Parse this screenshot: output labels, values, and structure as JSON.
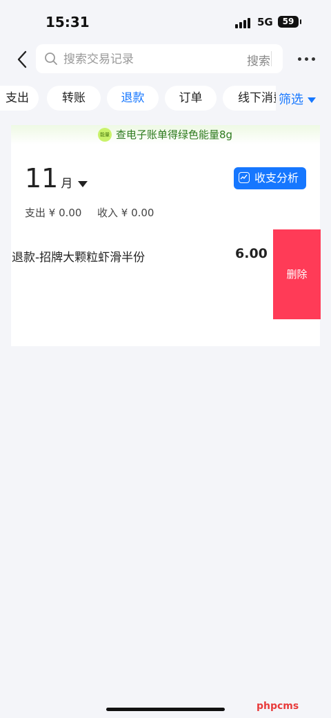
{
  "status_bar": {
    "time": "15:31",
    "network": "5G",
    "battery": "59"
  },
  "search": {
    "placeholder": "搜索交易记录",
    "button_label": "搜索"
  },
  "chips": [
    {
      "label": "支出"
    },
    {
      "label": "转账"
    },
    {
      "label": "退款"
    },
    {
      "label": "订单"
    },
    {
      "label": "线下消费"
    }
  ],
  "active_chip": "退款",
  "filter": {
    "label": "筛选"
  },
  "banner": {
    "badge": "能量",
    "text": "查电子账单得绿色能量8g"
  },
  "month": {
    "value": "11",
    "unit": "月"
  },
  "analysis_button": {
    "label": "收支分析"
  },
  "summary": {
    "expense": "支出 ¥ 0.00",
    "income": "收入 ¥ 0.00"
  },
  "records": [
    {
      "title": "退款-招牌大颗粒虾滑半份",
      "amount": "6.00"
    }
  ],
  "swipe_action": {
    "label": "删除"
  },
  "watermark": "phpcms",
  "colors": {
    "accent": "#1677ff",
    "delete": "#ff3b57",
    "banner_text": "#2d7a1e",
    "background": "#f4f5f9"
  }
}
